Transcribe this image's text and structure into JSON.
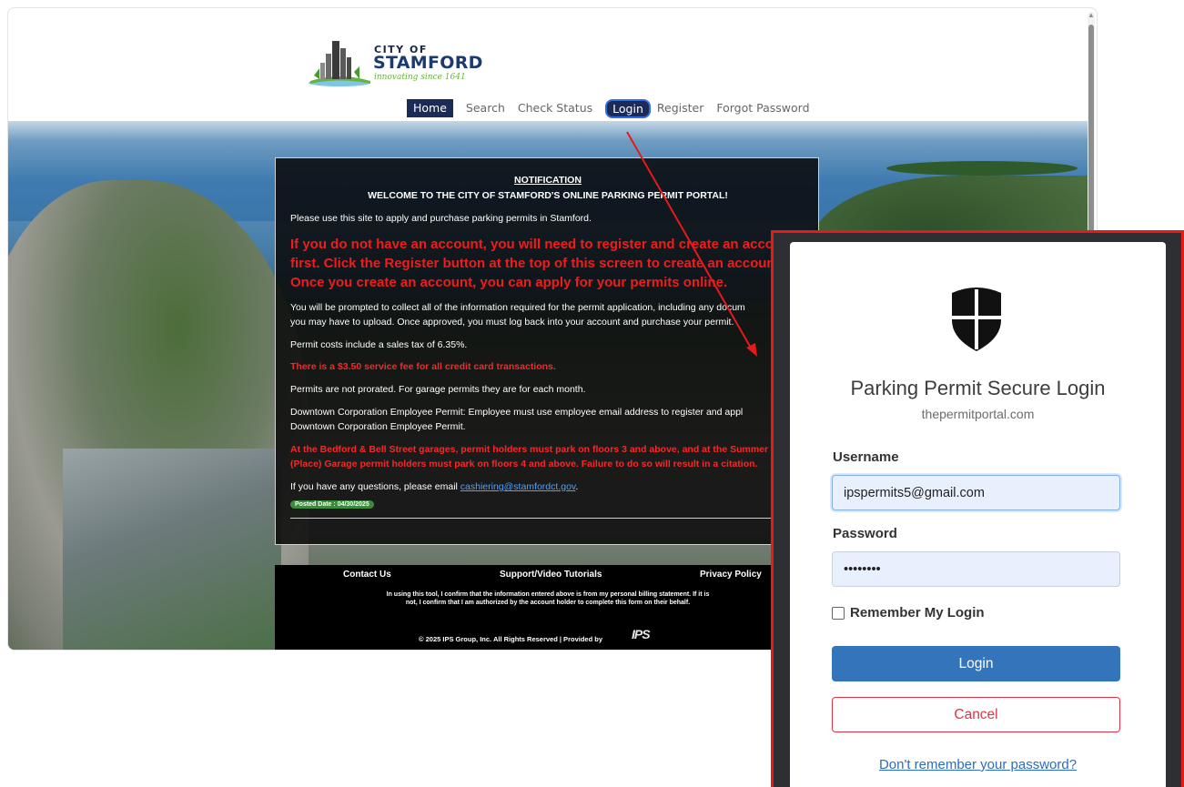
{
  "header": {
    "logo": {
      "line1": "CITY OF",
      "line2": "STAMFORD",
      "tagline": "innovating since 1641"
    },
    "nav": [
      {
        "label": "Home",
        "state": "active"
      },
      {
        "label": "Search",
        "state": "normal"
      },
      {
        "label": "Check Status",
        "state": "normal"
      },
      {
        "label": "Login",
        "state": "highlighted"
      },
      {
        "label": "Register",
        "state": "normal"
      },
      {
        "label": "Forgot Password",
        "state": "normal"
      }
    ]
  },
  "notification": {
    "title": "NOTIFICATION",
    "welcome": "WELCOME TO THE CITY OF STAMFORD'S ONLINE PARKING PERMIT PORTAL!",
    "intro": "Please use this site to apply and purchase parking permits in Stamford.",
    "account_warning": [
      "If you do not have an account, you will need to register and create an acco",
      "first. Click the Register button at the top of this screen to create an accoun",
      "Once you create an account, you can apply for your permits online."
    ],
    "prompt": [
      "You will be prompted to collect all of the information required for the permit application, including any docum",
      "you may have to upload. Once approved, you must log back into your account and purchase your permit."
    ],
    "tax": "Permit costs include a sales tax of 6.35%.",
    "service_fee": "There is a $3.50 service fee for all credit card transactions.",
    "proration": "Permits are not prorated. For garage permits they are for each month.",
    "downtown": [
      "Downtown Corporation Employee Permit: Employee must use employee email address to register and appl",
      "Downtown Corporation Employee Permit."
    ],
    "garage_rules": [
      "At the Bedford & Bell Street garages, permit holders must park on floors 3 and above, and at the Summer S",
      "(Place) Garage permit holders must park on floors 4 and above. Failure to do so will result in a citation."
    ],
    "questions_prefix": "If you have any questions, please email ",
    "questions_email": "cashiering@stamfordct.gov",
    "questions_suffix": ".",
    "posted_date": "Posted Date : 04/30/2025"
  },
  "footer": {
    "links": [
      "Contact Us",
      "Support/Video Tutorials",
      "Privacy Policy"
    ],
    "note": "In using this tool, I confirm that the information entered above is from my personal billing statement. If it is not, I confirm that I am authorized by the account holder to complete this form on their behalf.",
    "copyright": "© 2025 IPS Group, Inc. All Rights Reserved  |  Provided by",
    "provider_logo": "IPS"
  },
  "login": {
    "icon": "shield-icon",
    "title": "Parking Permit Secure Login",
    "domain": "thepermitportal.com",
    "username_label": "Username",
    "username_value": "ipspermits5@gmail.com",
    "password_label": "Password",
    "password_value": "••••••••",
    "remember_label": "Remember My Login",
    "login_button": "Login",
    "cancel_button": "Cancel",
    "forgot_link": "Don't remember your password?"
  },
  "colors": {
    "nav_active": "#1c2a56",
    "login_highlight": "#2f6de0",
    "annotation_red": "#e8191a",
    "login_button": "#3474ba",
    "cancel_border": "#dc3545",
    "link_blue": "#2a6cc6"
  }
}
